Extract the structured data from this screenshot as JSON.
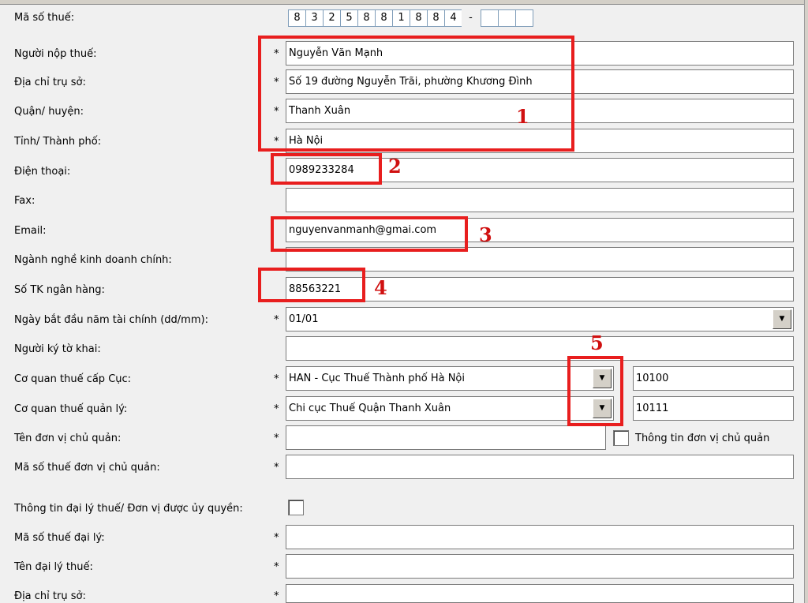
{
  "tax_code": {
    "label": "Mã số thuế:",
    "digits": [
      "8",
      "3",
      "2",
      "5",
      "8",
      "8",
      "1",
      "8",
      "8",
      "4"
    ],
    "dash": "-",
    "suffix": [
      "",
      "",
      ""
    ]
  },
  "taxpayer": {
    "label": "Người nộp thuế:",
    "required": "*",
    "value": "Nguyễn Văn Mạnh"
  },
  "address": {
    "label": "Địa chỉ trụ sở:",
    "required": "*",
    "value": "Số 19 đường Nguyễn Trãi, phường Khương Đình"
  },
  "district": {
    "label": "Quận/ huyện:",
    "required": "*",
    "value": "Thanh Xuân"
  },
  "province": {
    "label": "Tỉnh/ Thành phố:",
    "required": "*",
    "value": "Hà Nội"
  },
  "phone": {
    "label": "Điện thoại:",
    "value": "0989233284"
  },
  "fax": {
    "label": "Fax:",
    "value": ""
  },
  "email": {
    "label": "Email:",
    "value": "nguyenvanmanh@gmai.com"
  },
  "business": {
    "label": "Ngành nghề kinh doanh chính:",
    "value": ""
  },
  "bank": {
    "label": "Số TK ngân hàng:",
    "value": "88563221"
  },
  "fiscal_start": {
    "label": "Ngày bắt đầu năm tài chính (dd/mm):",
    "required": "*",
    "value": "01/01"
  },
  "signer": {
    "label": "Người ký tờ khai:",
    "value": ""
  },
  "tax_dept": {
    "label": "Cơ quan thuế cấp Cục:",
    "required": "*",
    "value": "HAN - Cục Thuế Thành phố Hà Nội",
    "code": "10100"
  },
  "tax_office": {
    "label": "Cơ quan thuế quản lý:",
    "required": "*",
    "value": "Chi cục Thuế Quận Thanh Xuân",
    "code": "10111"
  },
  "parent_unit": {
    "label": "Tên đơn vị chủ quản:",
    "required": "*",
    "value": "",
    "checkbox_label": "Thông tin đơn vị chủ quản"
  },
  "parent_tax_code": {
    "label": "Mã số thuế đơn vị chủ quản:",
    "required": "*",
    "value": ""
  },
  "agent_info": {
    "label": "Thông tin đại lý thuế/ Đơn vị được ủy quyền:"
  },
  "agent_tax_code": {
    "label": "Mã số thuế đại lý:",
    "required": "*",
    "value": ""
  },
  "agent_name": {
    "label": "Tên đại lý thuế:",
    "required": "*",
    "value": ""
  },
  "agent_address": {
    "label": "Địa chỉ trụ sở:",
    "required": "*",
    "value": ""
  },
  "annotations": [
    "1",
    "2",
    "3",
    "4",
    "5"
  ],
  "icons": {
    "dropdown": "chevron-down-icon"
  },
  "colors": {
    "annotation": "#e81e1e",
    "background": "#f0f0f0"
  }
}
